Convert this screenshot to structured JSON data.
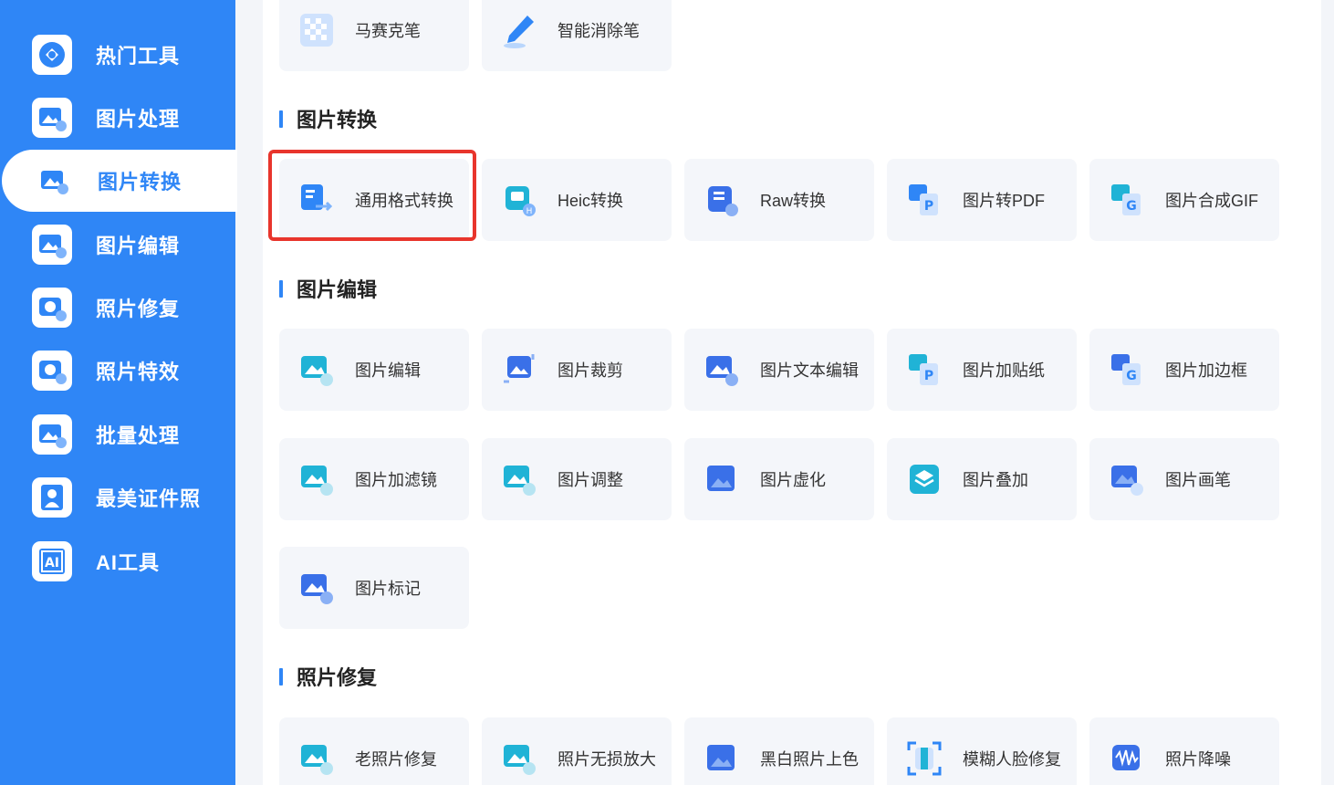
{
  "sidebar": {
    "items": [
      {
        "label": "热门工具",
        "icon": "hot-tools-icon"
      },
      {
        "label": "图片处理",
        "icon": "image-process-icon"
      },
      {
        "label": "图片转换",
        "icon": "image-convert-icon",
        "active": true
      },
      {
        "label": "图片编辑",
        "icon": "image-edit-icon"
      },
      {
        "label": "照片修复",
        "icon": "photo-repair-icon"
      },
      {
        "label": "照片特效",
        "icon": "photo-effects-icon"
      },
      {
        "label": "批量处理",
        "icon": "batch-process-icon"
      },
      {
        "label": "最美证件照",
        "icon": "id-photo-icon"
      },
      {
        "label": "AI工具",
        "icon": "ai-tools-icon"
      }
    ]
  },
  "top_row": [
    {
      "label": "马赛克笔",
      "icon": "mosaic-pen-icon"
    },
    {
      "label": "智能消除笔",
      "icon": "smart-eraser-icon"
    }
  ],
  "sections": {
    "convert": {
      "title": "图片转换",
      "cards": [
        {
          "label": "通用格式转换",
          "icon": "format-convert-icon",
          "highlighted": true
        },
        {
          "label": "Heic转换",
          "icon": "heic-convert-icon"
        },
        {
          "label": "Raw转换",
          "icon": "raw-convert-icon"
        },
        {
          "label": "图片转PDF",
          "icon": "image-to-pdf-icon"
        },
        {
          "label": "图片合成GIF",
          "icon": "image-to-gif-icon"
        }
      ]
    },
    "edit": {
      "title": "图片编辑",
      "cards": [
        {
          "label": "图片编辑",
          "icon": "image-edit-icon"
        },
        {
          "label": "图片裁剪",
          "icon": "image-crop-icon"
        },
        {
          "label": "图片文本编辑",
          "icon": "image-text-edit-icon"
        },
        {
          "label": "图片加贴纸",
          "icon": "image-sticker-icon"
        },
        {
          "label": "图片加边框",
          "icon": "image-border-icon"
        },
        {
          "label": "图片加滤镜",
          "icon": "image-filter-icon"
        },
        {
          "label": "图片调整",
          "icon": "image-adjust-icon"
        },
        {
          "label": "图片虚化",
          "icon": "image-blur-icon"
        },
        {
          "label": "图片叠加",
          "icon": "image-overlay-icon"
        },
        {
          "label": "图片画笔",
          "icon": "image-brush-icon"
        },
        {
          "label": "图片标记",
          "icon": "image-mark-icon"
        }
      ]
    },
    "repair": {
      "title": "照片修复",
      "cards": [
        {
          "label": "老照片修复",
          "icon": "old-photo-repair-icon"
        },
        {
          "label": "照片无损放大",
          "icon": "lossless-upscale-icon"
        },
        {
          "label": "黑白照片上色",
          "icon": "colorize-icon"
        },
        {
          "label": "模糊人脸修复",
          "icon": "face-repair-icon"
        },
        {
          "label": "照片降噪",
          "icon": "denoise-icon"
        }
      ]
    }
  },
  "colors": {
    "accent": "#2f86f6",
    "highlight": "#e8352c",
    "card_bg": "#f4f6fa"
  }
}
